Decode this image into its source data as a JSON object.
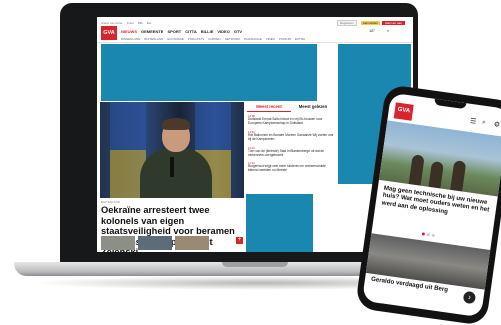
{
  "brand": {
    "logo_line1": "GVA",
    "logo_line2": "",
    "accent": "#d9232d",
    "ad_blue": "#1a87b0"
  },
  "topbar": {
    "items": [
      "Gazet van Antw.",
      "Krant",
      "Blik",
      "Bar"
    ],
    "register": "Registreer",
    "login": "Aanmelden",
    "alert": "Alarmen aan"
  },
  "mainnav": {
    "items": [
      "NIEUWS",
      "GEMEENTE",
      "SPORT",
      "CITTA",
      "BILLIE",
      "VIDEO",
      "GTV"
    ],
    "active_index": 0
  },
  "weather": "18°",
  "subnav": {
    "items": [
      "BINNENLAND",
      "BUITENLAND",
      "ECONOMIE",
      "PODCASTS",
      "KOPPEN",
      "NETWORK",
      "PAGINANGE",
      "VIDEO",
      "PODIUM",
      "EXTRA"
    ]
  },
  "hero": {
    "meta": "Buitenland",
    "title": "Oekraïne arresteert twee kolonels van eigen staatsveiligheid voor beramen van aanslag op president Zelenski",
    "plus_icon": "+"
  },
  "tabs": {
    "items": [
      "Meest recent",
      "Meest gelezen"
    ],
    "active_index": 0
  },
  "news_list": [
    {
      "time": "12:00",
      "text": "Duitsland Emma Salto Inkoot en vrij Ek-bouwen voor Europees Kampioenschap in Duitsland"
    },
    {
      "time": "11:52",
      "text": "Rdt Ballonnen en Bonaire Moreen Ganaanze Wij voelen ons bij de Kampioenen"
    },
    {
      "time": "11:40",
      "text": "Turn van de (kleinste) Stad in Blankenberge uit dat de verkenners overgebracht"
    },
    {
      "time": "11:30",
      "text": "Burgerhout krijgt veel meer kinderen en verkeersdrukte bekend weelden nu Meeste"
    }
  ],
  "phone": {
    "headline1": "Mag geen technische bij uw nieuwe huis? Wat moet ouders weten en het werd aan de oplossing",
    "headline2": "Geraldo verdaagd uit Berg",
    "arrow_icon": "›",
    "header_icons": [
      "☰",
      "⌕",
      "⚙"
    ]
  }
}
